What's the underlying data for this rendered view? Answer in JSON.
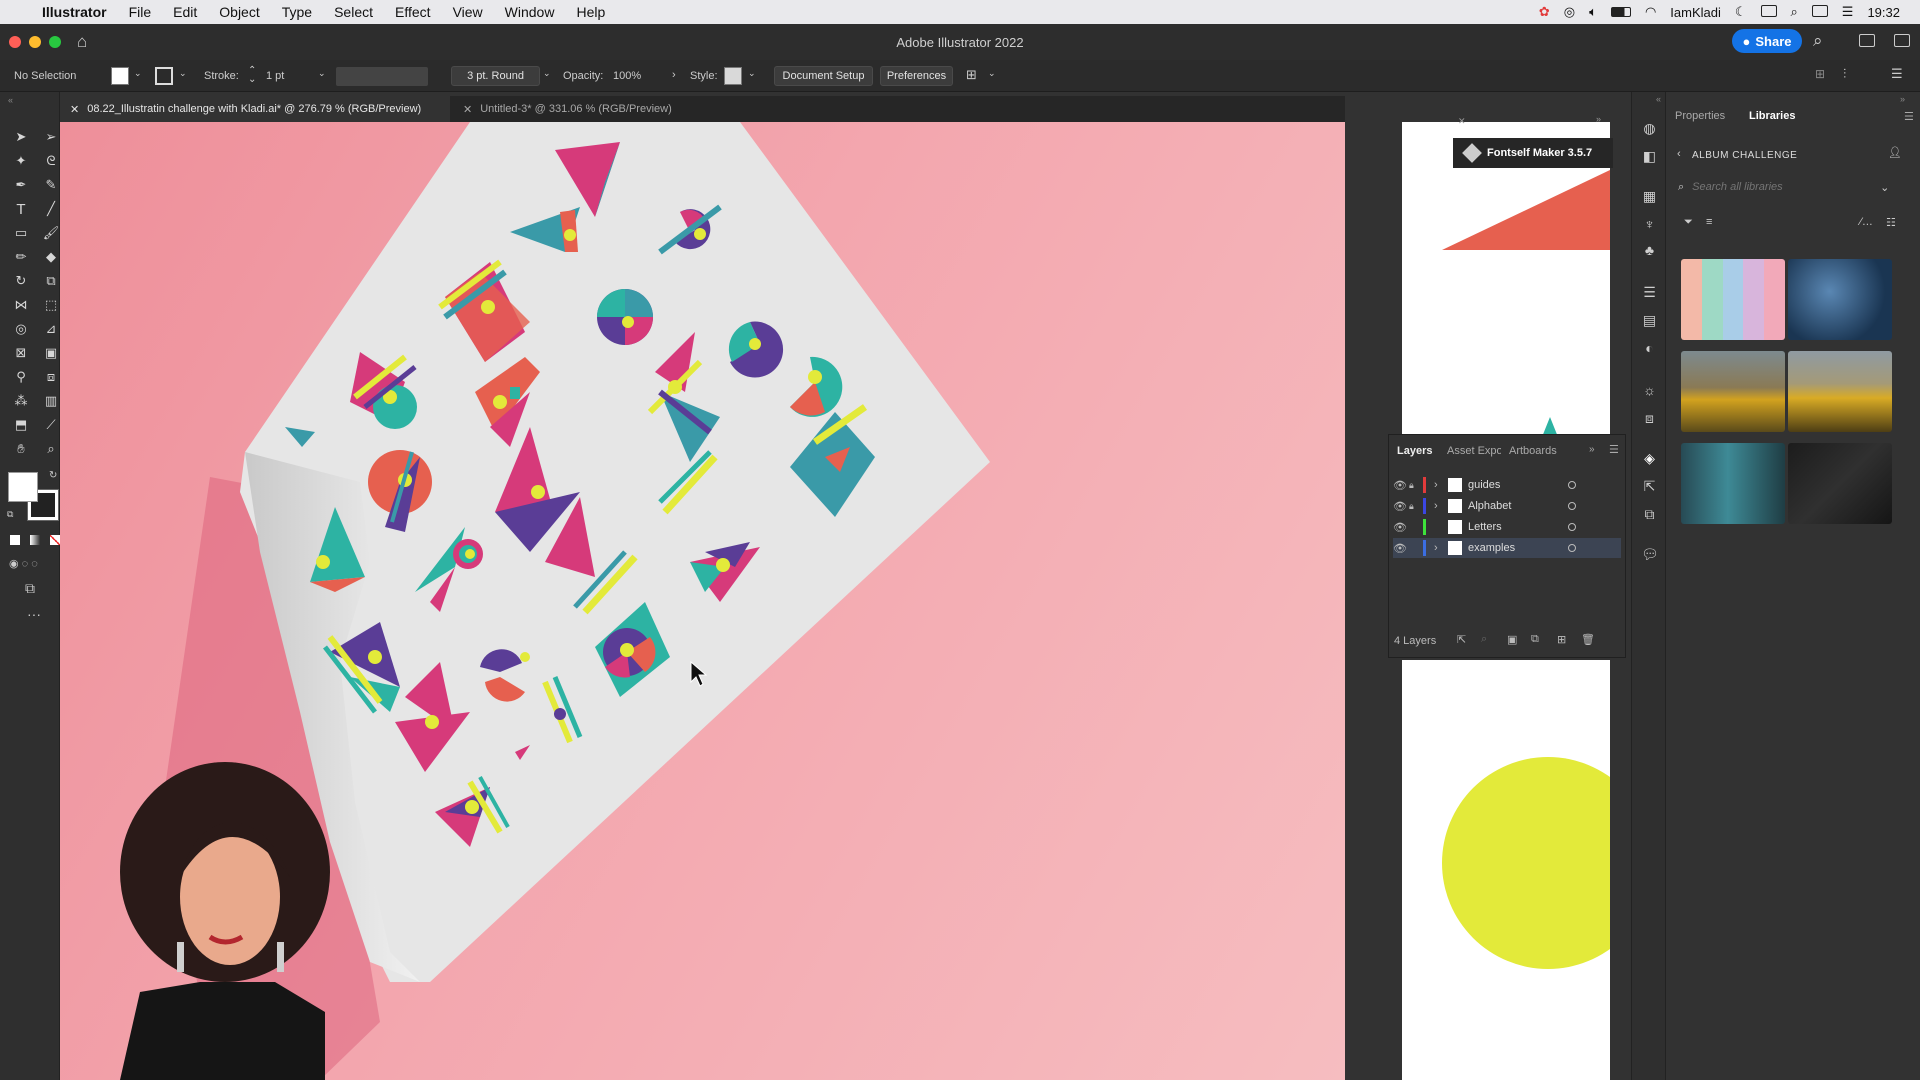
{
  "menubar": {
    "app_name": "Illustrator",
    "items": [
      "File",
      "Edit",
      "Object",
      "Type",
      "Select",
      "Effect",
      "View",
      "Window",
      "Help"
    ],
    "user": "IamKladi",
    "time": "19:32"
  },
  "window": {
    "title": "Adobe Illustrator 2022",
    "share_label": "Share"
  },
  "control_bar": {
    "selection": "No Selection",
    "stroke_label": "Stroke:",
    "stroke_value": "1 pt",
    "brush_value": "3 pt. Round",
    "opacity_label": "Opacity:",
    "opacity_value": "100%",
    "style_label": "Style:",
    "document_setup": "Document Setup",
    "preferences": "Preferences"
  },
  "tabs": [
    {
      "label": "08.22_Illustratin challenge with Kladi.ai* @ 276.79 % (RGB/Preview)",
      "active": true
    },
    {
      "label": "Untitled-3* @ 331.06 % (RGB/Preview)",
      "active": false
    }
  ],
  "fontself": {
    "label": "Fontself Maker 3.5.7"
  },
  "layers_panel": {
    "tabs": [
      "Layers",
      "Asset Expo",
      "Artboards"
    ],
    "layers": [
      {
        "name": "guides",
        "color": "#e23b3b",
        "locked": true
      },
      {
        "name": "Alphabet",
        "color": "#3b46e2",
        "locked": true
      },
      {
        "name": "Letters",
        "color": "#3ee23b",
        "locked": false
      },
      {
        "name": "examples",
        "color": "#3b6ee2",
        "locked": false
      }
    ],
    "count": "4 Layers"
  },
  "library_panel": {
    "tabs": [
      "Properties",
      "Libraries"
    ],
    "active_tab": "Libraries",
    "library_name": "ALBUM CHALLENGE",
    "search_placeholder": "Search all libraries"
  },
  "colors": {
    "accent": "#1473e6",
    "canvas_pink": "#f3a6ae",
    "teal": "#3a9aa8",
    "coral": "#e6604f",
    "purple": "#5a3d96",
    "yellow": "#e3ea3a",
    "magenta": "#d63a7a"
  }
}
